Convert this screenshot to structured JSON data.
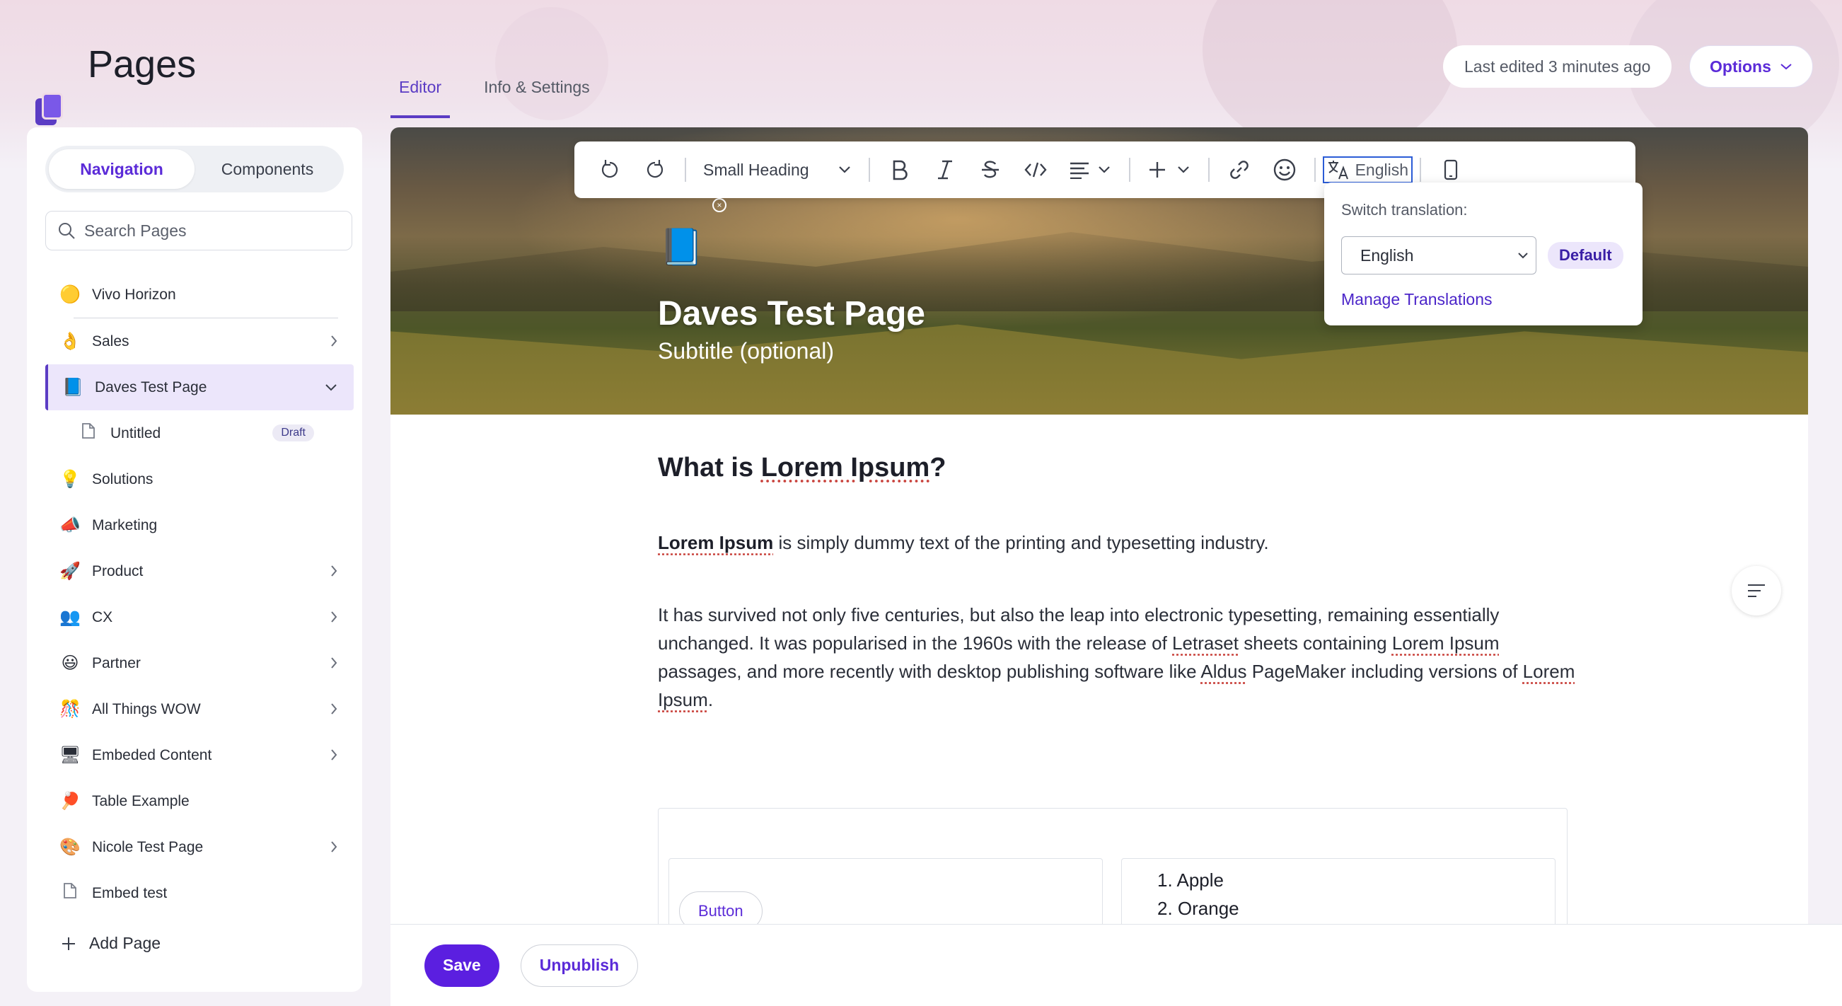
{
  "header": {
    "app_title": "Pages",
    "tabs": [
      {
        "label": "Editor"
      },
      {
        "label": "Info & Settings"
      }
    ],
    "last_edited": "Last edited 3 minutes ago",
    "options_label": "Options"
  },
  "sidebar": {
    "segments": [
      {
        "label": "Navigation"
      },
      {
        "label": "Components"
      }
    ],
    "search_placeholder": "Search Pages",
    "items": [
      {
        "emoji": "🟡",
        "label": "Vivo Horizon"
      },
      {
        "emoji": "👌",
        "label": "Sales"
      },
      {
        "emoji": "📘",
        "label": "Daves Test Page"
      },
      {
        "emoji": "📄",
        "label": "Untitled",
        "badge": "Draft"
      },
      {
        "emoji": "💡",
        "label": "Solutions"
      },
      {
        "emoji": "📣",
        "label": "Marketing"
      },
      {
        "emoji": "🚀",
        "label": "Product"
      },
      {
        "emoji": "👥",
        "label": "CX"
      },
      {
        "emoji": "😃",
        "label": "Partner"
      },
      {
        "emoji": "🎊",
        "label": "All Things WOW"
      },
      {
        "emoji": "🖥",
        "label": "Embeded Content"
      },
      {
        "emoji": "🏓",
        "label": "Table Example"
      },
      {
        "emoji": "🎨",
        "label": "Nicole Test Page"
      },
      {
        "emoji": "📄",
        "label": "Embed test"
      }
    ],
    "add_page_label": "Add Page"
  },
  "toolbar": {
    "block_type": "Small Heading",
    "language": "English"
  },
  "translation_popup": {
    "label": "Switch translation:",
    "selected": "English",
    "default_badge": "Default",
    "manage_link": "Manage Translations"
  },
  "hero": {
    "emoji": "📘",
    "title": "Daves Test Page",
    "subtitle": "Subtitle (optional)"
  },
  "content": {
    "heading_prefix": "What is ",
    "heading_term": "Lorem Ipsum",
    "heading_suffix": "?",
    "p1_bold": "Lorem Ipsum",
    "p1_rest": " is simply dummy text of the printing and typesetting industry.",
    "p2_a": "It has survived not only five centuries, but also the leap into electronic typesetting, remaining essentially unchanged. It was popularised in the 1960s with the release of ",
    "p2_letraset": "Letraset",
    "p2_b": " sheets containing ",
    "p2_lorem1": "Lorem Ipsum",
    "p2_c": " passages, and more recently with desktop publishing software like ",
    "p2_aldus": "Aldus",
    "p2_d": " PageMaker including versions of ",
    "p2_lorem2": "Lorem Ipsum",
    "p2_e": ".",
    "block_button": "Button",
    "list_items": [
      "Apple",
      "Orange"
    ]
  },
  "footer": {
    "save_label": "Save",
    "unpublish_label": "Unpublish"
  },
  "colors": {
    "accent": "#5b3cc4",
    "primary_button": "#5b1fe0"
  }
}
